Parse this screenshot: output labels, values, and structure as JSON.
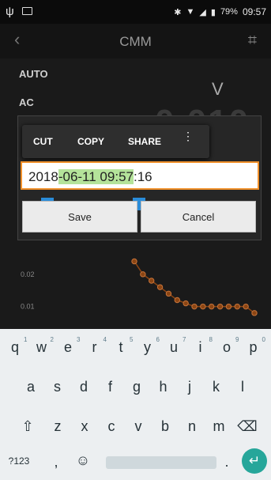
{
  "status": {
    "battery": "79%",
    "time": "09:57"
  },
  "app": {
    "back": "‹",
    "title": "CMM"
  },
  "meter": {
    "mode1": "AUTO",
    "mode2": "AC",
    "unit": "V",
    "value": "0.010"
  },
  "chart_data": {
    "type": "line",
    "y_tick_labels": [
      "0.02",
      "0.01"
    ],
    "points_y": [
      0.024,
      0.02,
      0.018,
      0.016,
      0.014,
      0.012,
      0.011,
      0.01,
      0.01,
      0.01,
      0.01,
      0.01,
      0.01,
      0.01,
      0.008
    ],
    "ylim": [
      0.006,
      0.03
    ]
  },
  "context_menu": {
    "cut": "CUT",
    "copy": "COPY",
    "share": "SHARE",
    "more": "⋮"
  },
  "dialog": {
    "input_before": "2018",
    "input_selected": "-06-11 09:57",
    "input_after": ":16",
    "save": "Save",
    "cancel": "Cancel"
  },
  "keyboard": {
    "row1": [
      "q",
      "w",
      "e",
      "r",
      "t",
      "y",
      "u",
      "i",
      "o",
      "p"
    ],
    "row1_digits": [
      "1",
      "2",
      "3",
      "4",
      "5",
      "6",
      "7",
      "8",
      "9",
      "0"
    ],
    "row2": [
      "a",
      "s",
      "d",
      "f",
      "g",
      "h",
      "j",
      "k",
      "l"
    ],
    "row3": [
      "z",
      "x",
      "c",
      "v",
      "b",
      "n",
      "m"
    ],
    "symbols": "?123",
    "comma": ",",
    "period": "."
  }
}
